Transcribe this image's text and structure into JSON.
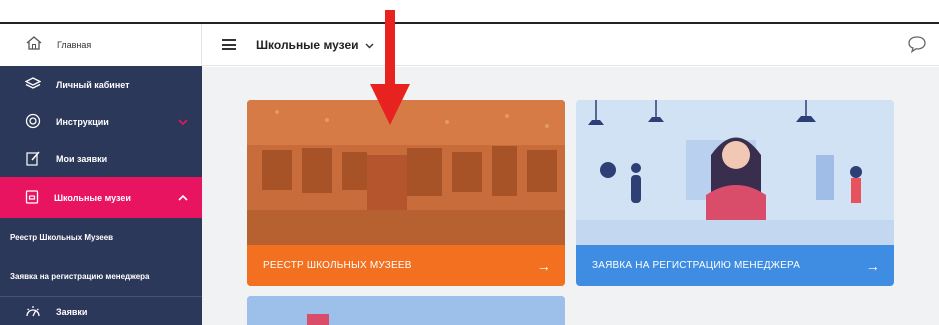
{
  "sidebar": {
    "home": {
      "label": "Главная",
      "icon": "home-icon"
    },
    "items": [
      {
        "label": "Личный кабинет",
        "icon": "layers-icon"
      },
      {
        "label": "Инструкции",
        "icon": "lifebuoy-icon"
      },
      {
        "label": "Мои заявки",
        "icon": "pen-document-icon"
      },
      {
        "label": "Школьные музеи",
        "icon": "museum-icon"
      }
    ],
    "subitems": [
      {
        "label": "Реестр Школьных Музеев"
      },
      {
        "label": "Заявка на регистрацию менеджера"
      }
    ],
    "last": {
      "label": "Заявки",
      "icon": "dashboard-icon"
    }
  },
  "header": {
    "title": "Школьные музеи",
    "title_icon": "chevron-down-icon",
    "menu_icon": "hamburger-icon",
    "chat_icon": "chat-bubble-icon"
  },
  "cards": [
    {
      "label": "РЕЕСТР ШКОЛЬНЫХ МУЗЕЕВ",
      "arrow": "→",
      "bar_color": "#f2701f"
    },
    {
      "label": "ЗАЯВКА НА РЕГИСТРАЦИЮ МЕНЕДЖЕРА",
      "arrow": "→",
      "bar_color": "#3f8de3"
    }
  ],
  "colors": {
    "sidebar_bg": "#2c3859",
    "active_bg": "#e8145f",
    "annotation_arrow": "#e8231f"
  }
}
